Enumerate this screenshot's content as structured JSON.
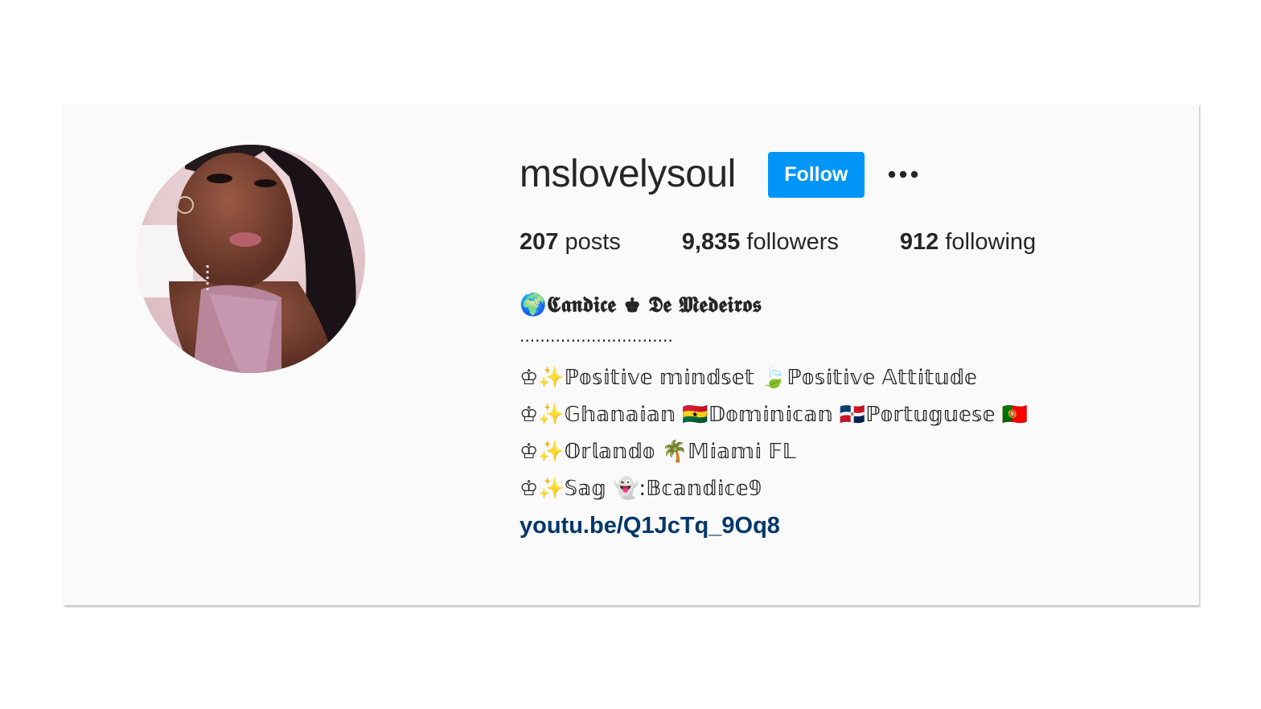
{
  "profile": {
    "username": "mslovelysoul",
    "follow_label": "Follow",
    "more_icon": "more-options-icon",
    "avatar_icon": "profile-photo",
    "stats": {
      "posts_count": "207",
      "posts_label": "posts",
      "followers_count": "9,835",
      "followers_label": "followers",
      "following_count": "912",
      "following_label": "following"
    },
    "bio": {
      "name": "🌍𝕮𝖆𝖓𝖉𝖎𝖈𝖊 ♚ 𝕯𝖊 𝕸𝖊𝖉𝖊𝖎𝖗𝖔𝖘",
      "dots": "..............................",
      "lines": [
        "♔✨ℙ𝕠𝕤𝕚𝕥𝕚𝕧𝕖 𝕞𝕚𝕟𝕕𝕤𝕖𝕥 🍃ℙ𝕠𝕤𝕚𝕥𝕚𝕧𝕖 𝔸𝕥𝕥𝕚𝕥𝕦𝕕𝕖",
        "♔✨𝔾𝕙𝕒𝕟𝕒𝕚𝕒𝕟 🇬🇭𝔻𝕠𝕞𝕚𝕟𝕚𝕔𝕒𝕟 🇩🇴ℙ𝕠𝕣𝕥𝕦𝕘𝕦𝕖𝕤𝕖 🇵🇹",
        "♔✨𝕆𝕣𝕝𝕒𝕟𝕕𝕠 🌴𝕄𝕚𝕒𝕞𝕚 𝔽𝕃",
        "♔✨𝕊𝕒𝕘 👻:𝔹𝕔𝕒𝕟𝕕𝕚𝕔𝕖𝟡"
      ],
      "link": "youtu.be/Q1JcTq_9Oq8"
    }
  },
  "colors": {
    "follow_button": "#0095f6",
    "link": "#00376b",
    "text": "#262626",
    "card_background": "#fafafa"
  }
}
